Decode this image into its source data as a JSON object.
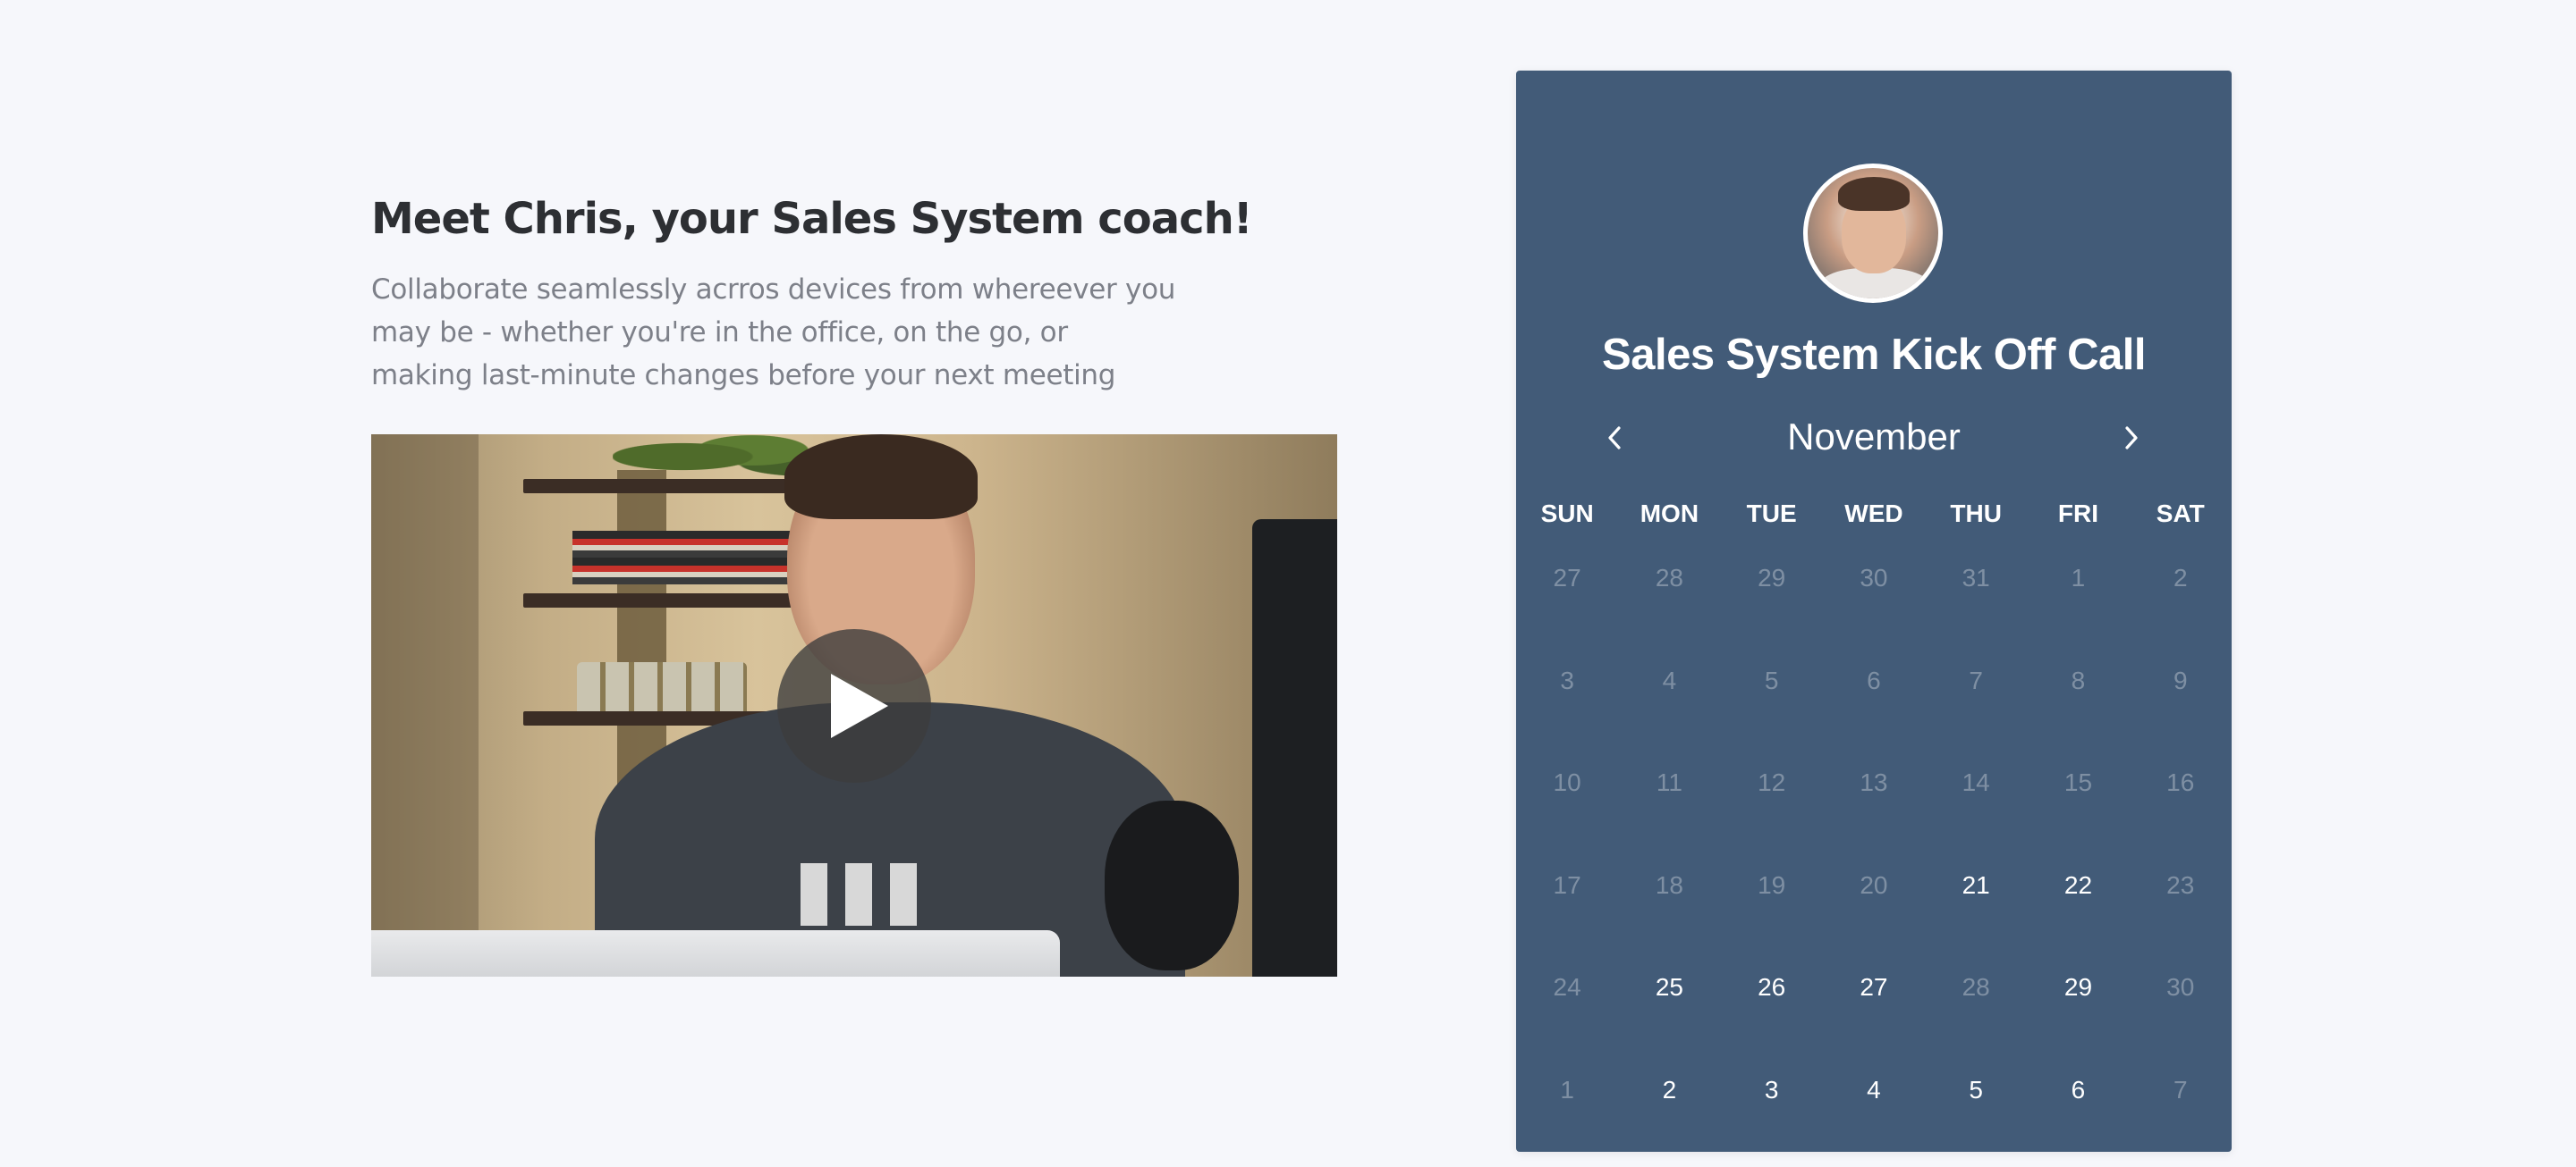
{
  "intro": {
    "headline": "Meet Chris, your Sales System coach!",
    "description": "Collaborate seamlessly acrros devices from whereever you may be - whether you're in the office, on the go, or making last-minute changes before your next meeting"
  },
  "video": {
    "play_icon": "play-icon"
  },
  "calendar": {
    "event_title": "Sales System Kick Off Call",
    "month": "November",
    "prev_icon": "chevron-left-icon",
    "next_icon": "chevron-right-icon",
    "weekdays": [
      "SUN",
      "MON",
      "TUE",
      "WED",
      "THU",
      "FRI",
      "SAT"
    ],
    "days": [
      {
        "label": "27",
        "available": false
      },
      {
        "label": "28",
        "available": false
      },
      {
        "label": "29",
        "available": false
      },
      {
        "label": "30",
        "available": false
      },
      {
        "label": "31",
        "available": false
      },
      {
        "label": "1",
        "available": false
      },
      {
        "label": "2",
        "available": false
      },
      {
        "label": "3",
        "available": false
      },
      {
        "label": "4",
        "available": false
      },
      {
        "label": "5",
        "available": false
      },
      {
        "label": "6",
        "available": false
      },
      {
        "label": "7",
        "available": false
      },
      {
        "label": "8",
        "available": false
      },
      {
        "label": "9",
        "available": false
      },
      {
        "label": "10",
        "available": false
      },
      {
        "label": "11",
        "available": false
      },
      {
        "label": "12",
        "available": false
      },
      {
        "label": "13",
        "available": false
      },
      {
        "label": "14",
        "available": false
      },
      {
        "label": "15",
        "available": false
      },
      {
        "label": "16",
        "available": false
      },
      {
        "label": "17",
        "available": false
      },
      {
        "label": "18",
        "available": false
      },
      {
        "label": "19",
        "available": false
      },
      {
        "label": "20",
        "available": false
      },
      {
        "label": "21",
        "available": true
      },
      {
        "label": "22",
        "available": true
      },
      {
        "label": "23",
        "available": false
      },
      {
        "label": "24",
        "available": false
      },
      {
        "label": "25",
        "available": true
      },
      {
        "label": "26",
        "available": true
      },
      {
        "label": "27",
        "available": true
      },
      {
        "label": "28",
        "available": false
      },
      {
        "label": "29",
        "available": true
      },
      {
        "label": "30",
        "available": false
      },
      {
        "label": "1",
        "available": false
      },
      {
        "label": "2",
        "available": true
      },
      {
        "label": "3",
        "available": true
      },
      {
        "label": "4",
        "available": true
      },
      {
        "label": "5",
        "available": true
      },
      {
        "label": "6",
        "available": true
      },
      {
        "label": "7",
        "available": false
      }
    ]
  },
  "colors": {
    "background": "#f6f7fb",
    "card": "#425b78",
    "headline": "#2d2f33",
    "description": "#7d8089"
  }
}
